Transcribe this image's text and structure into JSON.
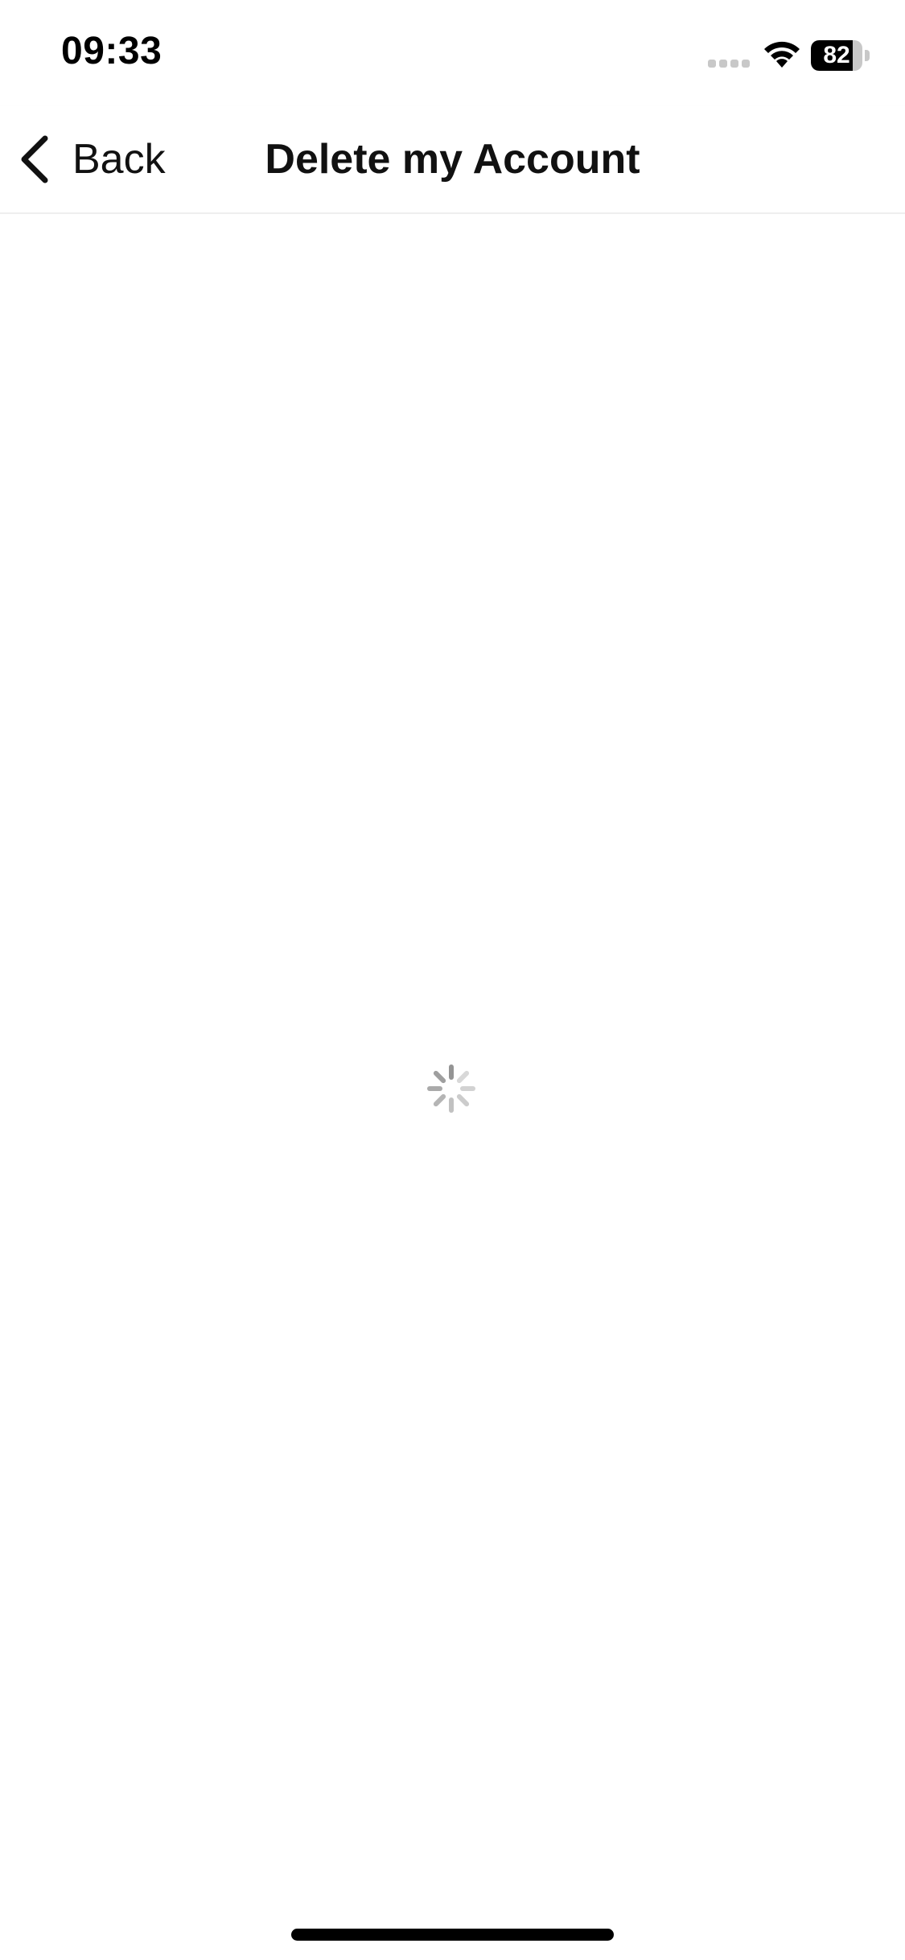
{
  "status_bar": {
    "time": "09:33",
    "battery_level": "82",
    "battery_percent": 82,
    "signal_icon": "cellular-signal-icon",
    "wifi_icon": "wifi-icon",
    "battery_icon": "battery-icon"
  },
  "nav": {
    "back_label": "Back",
    "back_icon": "chevron-left-icon",
    "title": "Delete my Account"
  },
  "content": {
    "loading_icon": "activity-spinner-icon"
  },
  "colors": {
    "background": "#ffffff",
    "text": "#111111",
    "spinner": "#8e8e8e",
    "divider": "#efefef"
  }
}
